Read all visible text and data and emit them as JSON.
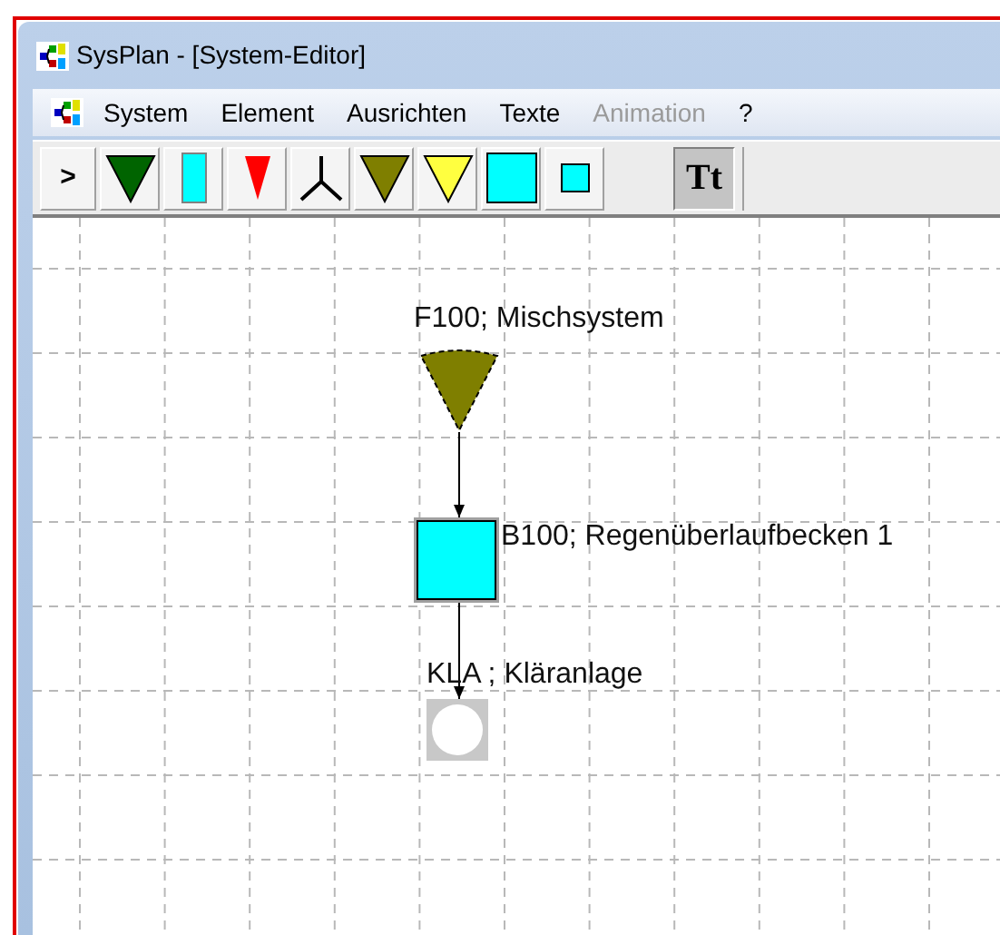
{
  "window": {
    "title": "SysPlan - [System-Editor]"
  },
  "menu": [
    {
      "label": "System",
      "disabled": false
    },
    {
      "label": "Element",
      "disabled": false
    },
    {
      "label": "Ausrichten",
      "disabled": false
    },
    {
      "label": "Texte",
      "disabled": false
    },
    {
      "label": "Animation",
      "disabled": true
    },
    {
      "label": "?",
      "disabled": false
    }
  ],
  "toolbar": [
    {
      "kind": "pointer",
      "label": ">",
      "selected": false
    },
    {
      "kind": "triangle",
      "color": "#006400",
      "selected": false
    },
    {
      "kind": "bar",
      "color": "#00ffff",
      "selected": false
    },
    {
      "kind": "small-triangle",
      "color": "#ff0000",
      "selected": false
    },
    {
      "kind": "splitter",
      "selected": false
    },
    {
      "kind": "triangle",
      "color": "#7f7f00",
      "selected": false
    },
    {
      "kind": "triangle",
      "color": "#ffff40",
      "selected": false
    },
    {
      "kind": "square",
      "color": "#00ffff",
      "selected": false
    },
    {
      "kind": "small-square",
      "color": "#00ffff",
      "selected": false
    },
    {
      "kind": "text",
      "label": "Tt",
      "selected": true
    }
  ],
  "diagram": {
    "nodes": [
      {
        "kind": "triangle",
        "color": "#7f7f00",
        "label": "F100; Mischsystem"
      },
      {
        "kind": "square",
        "color": "#00ffff",
        "label": "B100; Regenüberlaufbecken 1"
      },
      {
        "kind": "outlet",
        "color": "#c8c8c8",
        "label": "KLA ; Kläranlage"
      }
    ]
  }
}
